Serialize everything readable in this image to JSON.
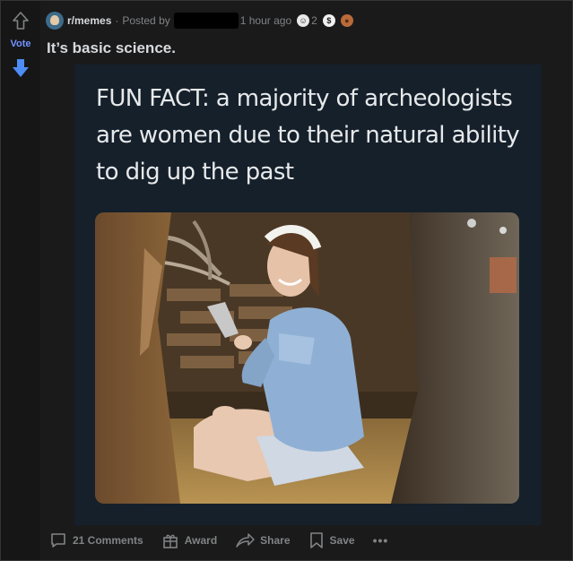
{
  "vote": {
    "label": "Vote"
  },
  "header": {
    "subreddit": "r/memes",
    "separator": "·",
    "posted_by": "Posted by",
    "time": "1 hour ago",
    "award_count": "2",
    "icons": [
      "subreddit-avatar-icon",
      "helpful-award-icon",
      "silver-award-icon",
      "poop-award-icon"
    ]
  },
  "post": {
    "title": "It’s basic science."
  },
  "media": {
    "caption": "FUN FACT: a majority of archeologists are women due to their natural ability to dig up the past"
  },
  "actions": {
    "comments": "21 Comments",
    "award": "Award",
    "share": "Share",
    "save": "Save",
    "more": "•••"
  },
  "colors": {
    "background": "#1a1a1b",
    "vote_accent": "#7193ff",
    "text_primary": "#d7dadc",
    "text_muted": "#818384",
    "media_bg": "#15202b"
  }
}
